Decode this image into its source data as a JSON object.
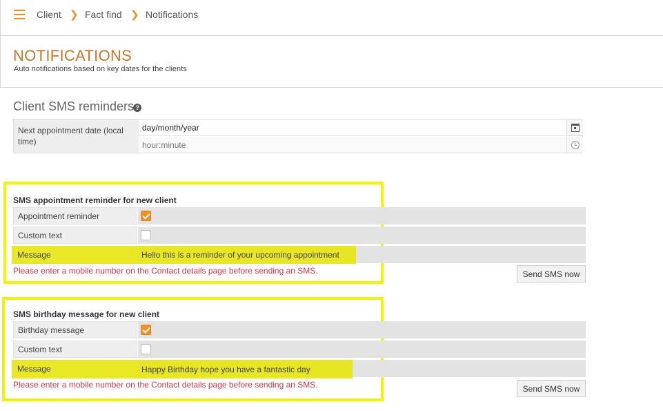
{
  "breadcrumb": {
    "items": [
      "Client",
      "Fact find",
      "Notifications"
    ]
  },
  "page": {
    "title": "NOTIFICATIONS",
    "subtitle": "Auto notifications based on key dates for the clients"
  },
  "client_sms": {
    "title": "Client SMS reminders",
    "help_glyph": "?",
    "next_appointment_label": "Next appointment date (local time)",
    "date_value": "day/month/year",
    "time_placeholder": "hour:minute"
  },
  "appointment_reminder": {
    "title": "SMS appointment reminder for new client",
    "reminder_label": "Appointment reminder",
    "reminder_checked": true,
    "custom_text_label": "Custom text",
    "custom_text_checked": false,
    "message_label": "Message",
    "message_value": "Hello this is a reminder of your upcoming appointment",
    "warning": "Please enter a mobile number on the Contact details page before sending an SMS.",
    "send_button": "Send SMS now"
  },
  "birthday_message": {
    "title": "SMS birthday message for new client",
    "birthday_label": "Birthday message",
    "birthday_checked": true,
    "custom_text_label": "Custom text",
    "custom_text_checked": false,
    "message_label": "Message",
    "message_value": "Happy Birthday hope you have a fantastic day",
    "warning": "Please enter a mobile number on the Contact details page before sending an SMS.",
    "send_button": "Send SMS now"
  },
  "colors": {
    "accent": "#f0922a",
    "title": "#c8762a",
    "warning": "#e0344a",
    "highlight": "#f4f400"
  }
}
